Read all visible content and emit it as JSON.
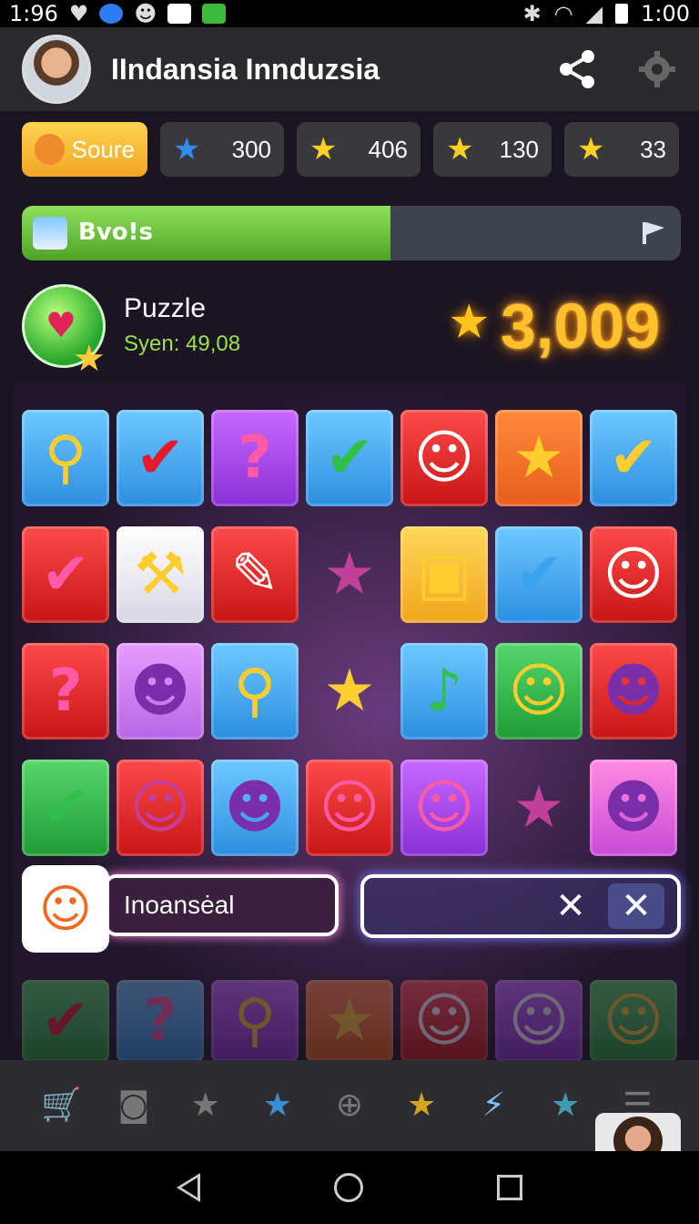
{
  "status_bar": {
    "time_left": "1:96",
    "time_right": "1:00"
  },
  "header": {
    "title": "IIndansia Innduzsia"
  },
  "resources": {
    "score_label": "Soure",
    "item1_value": "300",
    "item2_value": "406",
    "item3_value": "130",
    "item4_value": "33"
  },
  "progress": {
    "label": "Bvo!s",
    "fraction": 0.56
  },
  "puzzle": {
    "title": "Puzzle",
    "subtitle": "Syen: 49,08",
    "score": "3,009"
  },
  "board": {
    "rows": [
      [
        {
          "color": "c-blue",
          "icon": "pin-icon",
          "glyph": "⚲",
          "tint": "g-gold"
        },
        {
          "color": "c-blue",
          "icon": "check-icon",
          "glyph": "✔",
          "tint": "g-red"
        },
        {
          "color": "c-purple",
          "icon": "question-icon",
          "glyph": "?",
          "tint": "g-pink"
        },
        {
          "color": "c-blue",
          "icon": "check-icon",
          "glyph": "✔",
          "tint": "g-green"
        },
        {
          "color": "c-red",
          "icon": "ghost-icon",
          "glyph": "☺",
          "tint": "g-white"
        },
        {
          "color": "c-orange",
          "icon": "star-icon",
          "glyph": "★",
          "tint": "g-gold"
        },
        {
          "color": "c-blue",
          "icon": "check-icon",
          "glyph": "✔",
          "tint": "g-gold"
        }
      ],
      [
        {
          "color": "c-red",
          "icon": "check-icon",
          "glyph": "✔",
          "tint": "g-pink"
        },
        {
          "color": "c-white",
          "icon": "hammer-icon",
          "glyph": "⚒",
          "tint": "g-gold"
        },
        {
          "color": "c-red",
          "icon": "pen-icon",
          "glyph": "✎",
          "tint": "g-white"
        },
        {
          "color": "c-none",
          "icon": "star-icon",
          "glyph": "★",
          "tint": "g-dpink"
        },
        {
          "color": "c-yellow",
          "icon": "box-icon",
          "glyph": "▣",
          "tint": "g-gold"
        },
        {
          "color": "c-blue",
          "icon": "check-icon",
          "glyph": "✔",
          "tint": "g-lblue"
        },
        {
          "color": "c-red",
          "icon": "ghost-icon",
          "glyph": "☺",
          "tint": "g-white"
        }
      ],
      [
        {
          "color": "c-red",
          "icon": "question-icon",
          "glyph": "?",
          "tint": "g-pink"
        },
        {
          "color": "c-lilac",
          "icon": "cat-icon",
          "glyph": "☻",
          "tint": "g-purple"
        },
        {
          "color": "c-blue",
          "icon": "pin-icon",
          "glyph": "⚲",
          "tint": "g-gold"
        },
        {
          "color": "c-none",
          "icon": "star-icon",
          "glyph": "★",
          "tint": "g-gold"
        },
        {
          "color": "c-blue",
          "icon": "music-note-icon",
          "glyph": "♪",
          "tint": "g-green"
        },
        {
          "color": "c-green",
          "icon": "cat-icon",
          "glyph": "☺",
          "tint": "g-gold"
        },
        {
          "color": "c-red",
          "icon": "creature-icon",
          "glyph": "☻",
          "tint": "g-purple"
        }
      ],
      [
        {
          "color": "c-green",
          "icon": "check-icon",
          "glyph": "✔",
          "tint": "g-green"
        },
        {
          "color": "c-red",
          "icon": "figure-icon",
          "glyph": "☺",
          "tint": "g-dpink"
        },
        {
          "color": "c-blue",
          "icon": "cat-icon",
          "glyph": "☻",
          "tint": "g-purple"
        },
        {
          "color": "c-red",
          "icon": "cat-icon",
          "glyph": "☺",
          "tint": "g-pink"
        },
        {
          "color": "c-purple",
          "icon": "cat-icon",
          "glyph": "☺",
          "tint": "g-pink"
        },
        {
          "color": "c-none",
          "icon": "star-icon",
          "glyph": "★",
          "tint": "g-dpink"
        },
        {
          "color": "c-pink",
          "icon": "creature-icon",
          "glyph": "☻",
          "tint": "g-purple"
        }
      ]
    ],
    "faded_row": [
      {
        "color": "c-green",
        "icon": "check-icon",
        "glyph": "✔",
        "tint": "g-red"
      },
      {
        "color": "c-blue",
        "icon": "question-icon",
        "glyph": "?",
        "tint": "g-pink"
      },
      {
        "color": "c-purple",
        "icon": "pin-icon",
        "glyph": "⚲",
        "tint": "g-gold"
      },
      {
        "color": "c-orange",
        "icon": "star-icon",
        "glyph": "★",
        "tint": "g-gold"
      },
      {
        "color": "c-red",
        "icon": "ghost-icon",
        "glyph": "☺",
        "tint": "g-white"
      },
      {
        "color": "c-purple",
        "icon": "ghost-icon",
        "glyph": "☺",
        "tint": "g-white"
      },
      {
        "color": "c-green",
        "icon": "cat-icon",
        "glyph": "☺",
        "tint": "g-gold"
      }
    ]
  },
  "word_bar": {
    "text": "Inoansėal"
  },
  "toolbar": {
    "items": [
      {
        "name": "cart-icon",
        "glyph": "🛒",
        "cls": "cart"
      },
      {
        "name": "camera-icon",
        "glyph": "◙",
        "cls": ""
      },
      {
        "name": "star-icon",
        "glyph": "★",
        "cls": ""
      },
      {
        "name": "star-icon",
        "glyph": "★",
        "cls": "s-blue"
      },
      {
        "name": "add-icon",
        "glyph": "⊕",
        "cls": ""
      },
      {
        "name": "star-icon",
        "glyph": "★",
        "cls": "s-gold"
      },
      {
        "name": "magic-wand-icon",
        "glyph": "⚡",
        "cls": "wand"
      },
      {
        "name": "star-icon",
        "glyph": "★",
        "cls": "s-teal"
      },
      {
        "name": "menu-icon",
        "glyph": "☰",
        "cls": ""
      }
    ]
  },
  "colors": {
    "accent_gold": "#ffc12b",
    "progress_green": "#5fb82f"
  }
}
